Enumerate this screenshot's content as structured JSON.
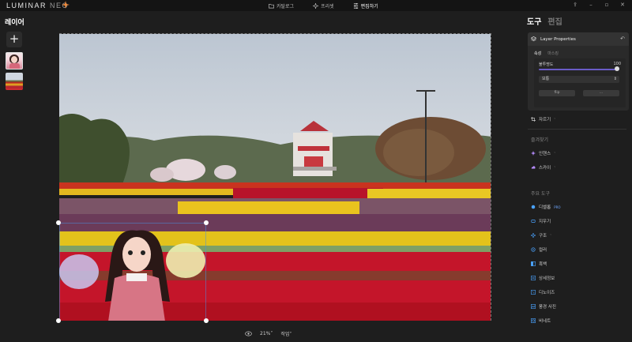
{
  "app": {
    "logo_text": "LUMINAR",
    "logo_suffix": "NEO"
  },
  "tabs": [
    {
      "label": "카탈로그",
      "icon": "folder-icon"
    },
    {
      "label": "프리셋",
      "icon": "sparkle-icon"
    },
    {
      "label": "편집하기",
      "icon": "sliders-icon"
    }
  ],
  "window_controls": [
    "share-icon",
    "minimize-icon",
    "maximize-icon",
    "close-icon"
  ],
  "layers_panel": {
    "title": "레이어",
    "add_label": "+"
  },
  "bottom_bar": {
    "zoom": "21%",
    "zoom_caret": "˅",
    "action": "작업",
    "action_caret": "˅"
  },
  "right_panel": {
    "tab_tools": "도구",
    "tab_edit": "편집",
    "layer_properties": {
      "title": "Layer Properties",
      "reset_icon": "↶",
      "subtab_properties": "속성",
      "subtab_masking": "마스킹",
      "opacity_label": "불투명도",
      "opacity_value": "100",
      "opacity_fraction": 1.0,
      "blend_mode": "보통",
      "blend_caret": "⇕",
      "btn_left": "flip",
      "btn_right": "..."
    },
    "crop": {
      "label": "자르기",
      "caret": "˅"
    },
    "favorites_title": "즐겨찾기",
    "favorites": [
      {
        "label": "인핸스",
        "caret": "˅",
        "color": "#b78cff"
      },
      {
        "label": "스카이",
        "caret": "˅",
        "color": "#b78cff"
      }
    ],
    "main_tools_title": "주요 도구",
    "main_tools": [
      {
        "label": "디벨롭",
        "badge": "PRO"
      },
      {
        "label": "지우기",
        "badge": ""
      },
      {
        "label": "구조",
        "badge": "˅"
      },
      {
        "label": "컬러",
        "badge": ""
      },
      {
        "label": "흑백",
        "badge": ""
      },
      {
        "label": "상세정보",
        "badge": ""
      },
      {
        "label": "디노이즈",
        "badge": ""
      },
      {
        "label": "풍경 사진",
        "badge": ""
      },
      {
        "label": "비네트",
        "badge": ""
      }
    ]
  }
}
